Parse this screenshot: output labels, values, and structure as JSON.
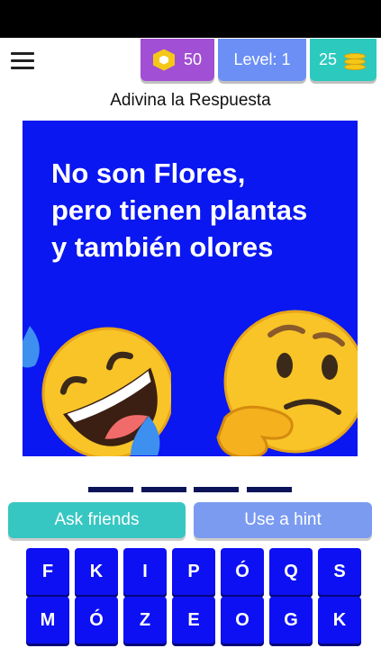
{
  "header": {
    "gems": "50",
    "level": "Level: 1",
    "coins": "25"
  },
  "title": "Adivina la Respuesta",
  "puzzle": {
    "lines": [
      "No son Flores,",
      "pero tienen plantas",
      "y también olores"
    ],
    "background_color": "#0a17f0",
    "emojis": [
      "rolling-on-floor-laughing-emoji",
      "thinking-face-emoji"
    ]
  },
  "answer_slots": 4,
  "actions": {
    "ask_friends": "Ask friends",
    "use_hint": "Use a hint"
  },
  "keyboard": {
    "row1": [
      "F",
      "K",
      "I",
      "P",
      "Ó",
      "Q",
      "S"
    ],
    "row2": [
      "M",
      "Ó",
      "Z",
      "E",
      "O",
      "G",
      "K"
    ]
  },
  "colors": {
    "gems_pill": "#a14fd4",
    "level_pill": "#6b8ff5",
    "coins_pill": "#2bc9be",
    "ask_button": "#37c7c2",
    "hint_button": "#7a9bf0",
    "key": "#0d10f2"
  }
}
